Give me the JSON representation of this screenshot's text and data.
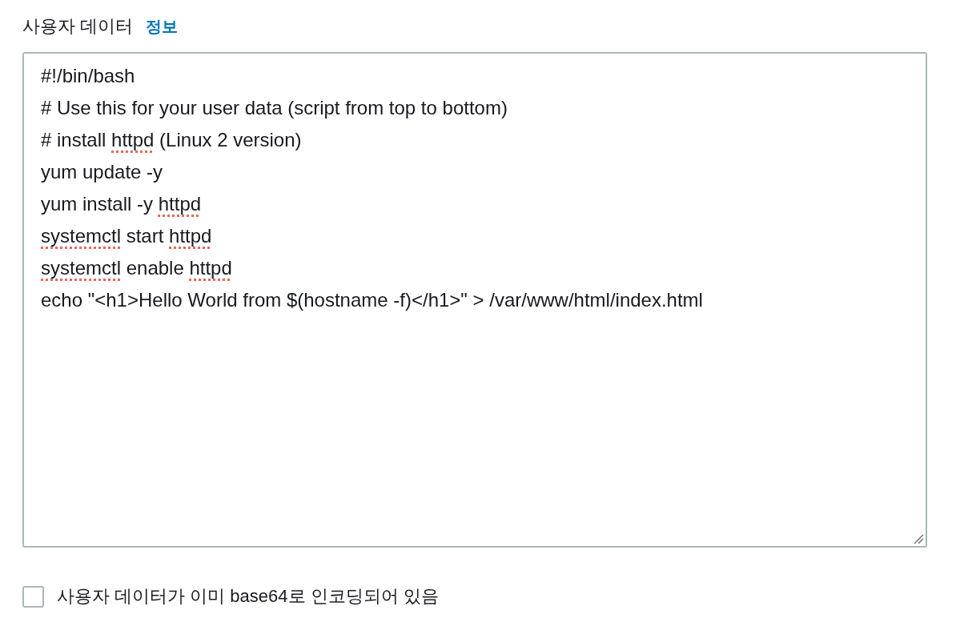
{
  "field": {
    "label": "사용자 데이터",
    "info_link": "정보"
  },
  "user_data": {
    "lines": [
      {
        "segments": [
          {
            "text": "#!/bin/bash",
            "misspelled": false
          }
        ]
      },
      {
        "segments": [
          {
            "text": "# Use this for your user data (script from top to bottom)",
            "misspelled": false
          }
        ]
      },
      {
        "segments": [
          {
            "text": "# install ",
            "misspelled": false
          },
          {
            "text": "httpd",
            "misspelled": true
          },
          {
            "text": " (Linux 2 version)",
            "misspelled": false
          }
        ]
      },
      {
        "segments": [
          {
            "text": "yum update -y",
            "misspelled": false
          }
        ]
      },
      {
        "segments": [
          {
            "text": "yum install -y ",
            "misspelled": false
          },
          {
            "text": "httpd",
            "misspelled": true
          }
        ]
      },
      {
        "segments": [
          {
            "text": "systemctl",
            "misspelled": true
          },
          {
            "text": " start ",
            "misspelled": false
          },
          {
            "text": "httpd",
            "misspelled": true
          }
        ]
      },
      {
        "segments": [
          {
            "text": "systemctl",
            "misspelled": true
          },
          {
            "text": " enable ",
            "misspelled": false
          },
          {
            "text": "httpd",
            "misspelled": true
          }
        ]
      },
      {
        "segments": [
          {
            "text": "echo \"<h1>Hello World from $(hostname -f)</h1>\" > /var/www/html/index.html",
            "misspelled": false
          }
        ]
      }
    ]
  },
  "base64_checkbox": {
    "label": "사용자 데이터가 이미 base64로 인코딩되어 있음",
    "checked": false
  }
}
